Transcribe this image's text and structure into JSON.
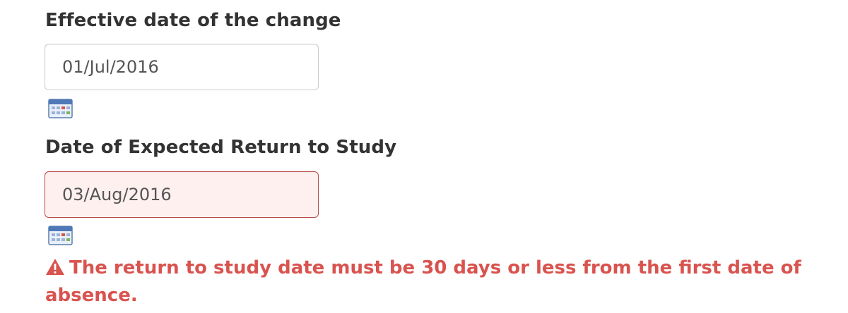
{
  "effective_date": {
    "label": "Effective date of the change",
    "value": "01/Jul/2016",
    "calendar_icon": "calendar-icon"
  },
  "return_date": {
    "label": "Date of Expected Return to Study",
    "value": "03/Aug/2016",
    "calendar_icon": "calendar-icon",
    "error_state": true
  },
  "validation": {
    "icon": "warning-icon",
    "message": "The return to study date must be 30 days or less from the first date of absence."
  },
  "colors": {
    "error_text": "#d9534f",
    "error_border": "#b94a48",
    "error_background": "#fff0f0",
    "label_text": "#333333"
  }
}
